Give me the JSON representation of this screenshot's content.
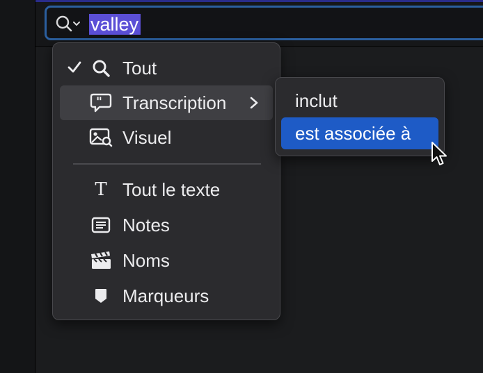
{
  "search": {
    "query": "valley",
    "icons": [
      "magnifier-icon",
      "chevron-down-icon"
    ]
  },
  "menu": {
    "items": [
      {
        "label": "Tout",
        "icon": "magnifier-icon",
        "checked": true
      },
      {
        "label": "Transcription",
        "icon": "speech-bubble-quote-icon",
        "has_submenu": true,
        "highlighted": true
      },
      {
        "label": "Visuel",
        "icon": "image-search-icon"
      },
      {
        "label": "Tout le texte",
        "icon": "serif-t-icon",
        "glyph": "T"
      },
      {
        "label": "Notes",
        "icon": "notes-icon"
      },
      {
        "label": "Noms",
        "icon": "clapperboard-icon"
      },
      {
        "label": "Marqueurs",
        "icon": "marker-icon"
      }
    ]
  },
  "submenu": {
    "items": [
      {
        "label": "inclut"
      },
      {
        "label": "est associée à",
        "selected": true
      }
    ]
  },
  "colors": {
    "accent_selection": "#1e5bc6",
    "text_highlight": "#5b4fd6",
    "field_border": "#2b5f9f",
    "menu_bg": "#2b2b2e"
  }
}
